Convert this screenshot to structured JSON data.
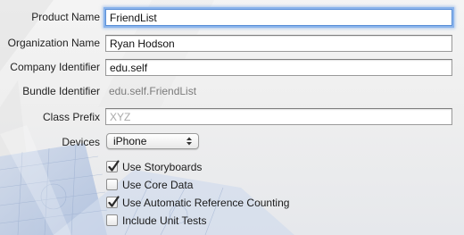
{
  "form": {
    "product_name": {
      "label": "Product Name",
      "value": "FriendList"
    },
    "organization_name": {
      "label": "Organization Name",
      "value": "Ryan Hodson"
    },
    "company_identifier": {
      "label": "Company Identifier",
      "value": "edu.self"
    },
    "bundle_identifier": {
      "label": "Bundle Identifier",
      "value": "edu.self.FriendList"
    },
    "class_prefix": {
      "label": "Class Prefix",
      "value": "",
      "placeholder": "XYZ"
    },
    "devices": {
      "label": "Devices",
      "selected": "iPhone"
    }
  },
  "options": [
    {
      "label": "Use Storyboards",
      "checked": true
    },
    {
      "label": "Use Core Data",
      "checked": false
    },
    {
      "label": "Use Automatic Reference Counting",
      "checked": true
    },
    {
      "label": "Include Unit Tests",
      "checked": false
    }
  ],
  "colors": {
    "focus_ring": "#8ab4ec",
    "checkmark": "#2a2a2a",
    "background": "#ececec"
  }
}
